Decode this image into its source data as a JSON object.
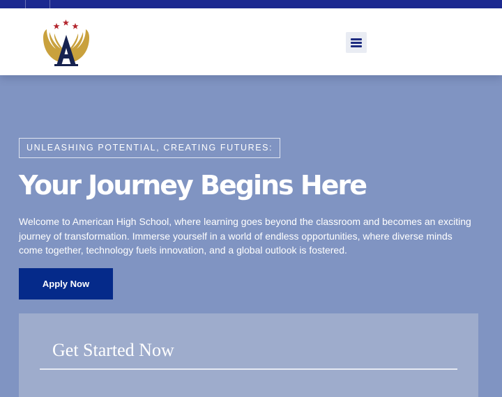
{
  "colors": {
    "top_bar": "#1c2990",
    "header_bg": "#ffffff",
    "hero_bg": "#8094c2",
    "primary_button": "#052a8a",
    "form_card_bg": "#9eaccc",
    "logo_gold": "#c9a13d",
    "logo_navy": "#16224f",
    "logo_star": "#b3262e"
  },
  "header": {
    "logo_icon": "school-crest-logo-icon",
    "menu_icon": "hamburger-menu-icon"
  },
  "hero": {
    "tagline": "UNLEASHING POTENTIAL, CREATING FUTURES:",
    "headline": "Your Journey Begins Here",
    "intro": "Welcome to American High School, where learning goes beyond the classroom and becomes an exciting journey of transformation. Immerse yourself in a world of endless opportunities, where diverse minds come together, technology fuels innovation, and a global outlook is fostered.",
    "apply_label": "Apply Now"
  },
  "form": {
    "title": "Get Started Now"
  }
}
